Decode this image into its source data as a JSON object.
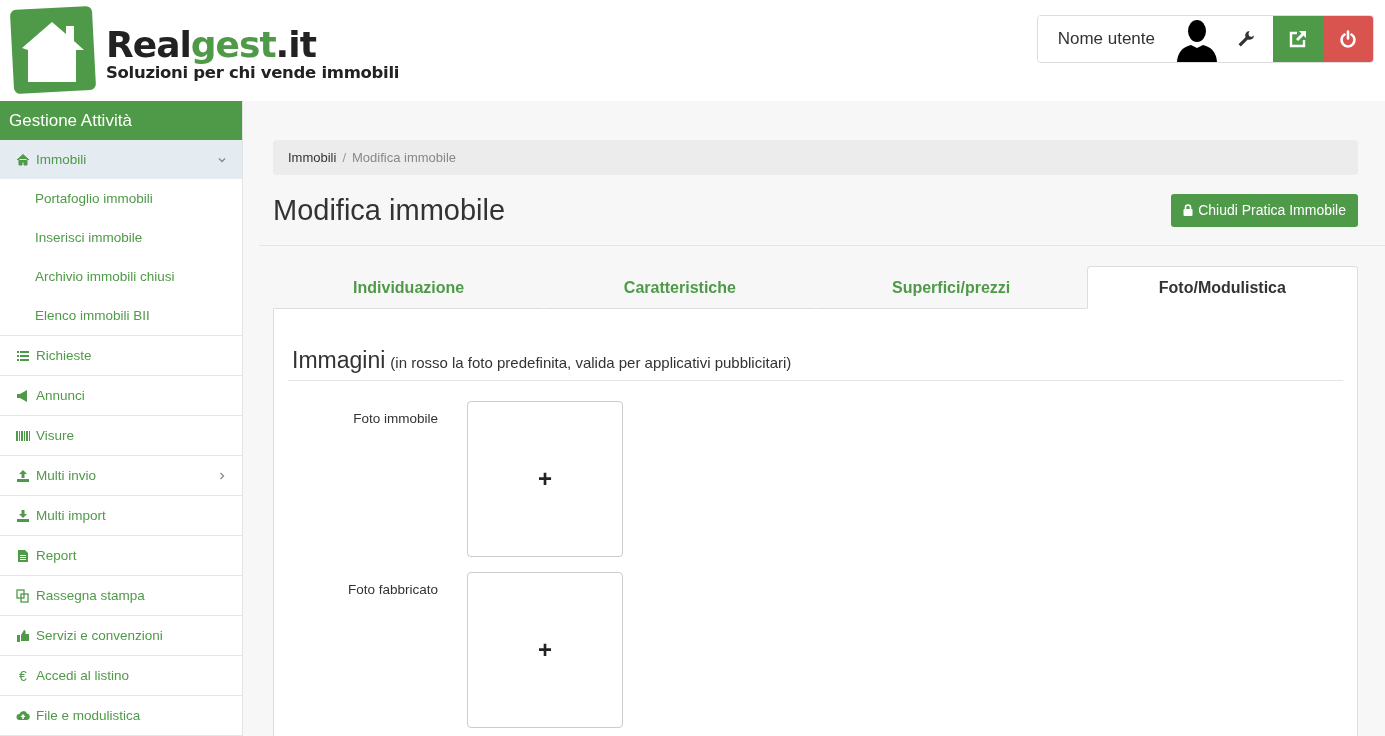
{
  "logo": {
    "brand_dark": "Real",
    "brand_green": "gest",
    "brand_suffix": ".it",
    "tagline": "Soluzioni per chi vende immobili"
  },
  "user_bar": {
    "user_name": "Nome utente"
  },
  "sidebar": {
    "title": "Gestione Attività",
    "items": [
      {
        "label": "Immobili",
        "kind": "group",
        "expanded": true,
        "selected": true,
        "children": [
          {
            "label": "Portafoglio immobili"
          },
          {
            "label": "Inserisci immobile"
          },
          {
            "label": "Archivio immobili chiusi"
          },
          {
            "label": "Elenco immobili BII"
          }
        ]
      },
      {
        "label": "Richieste",
        "kind": "link",
        "selected": false
      },
      {
        "label": "Annunci",
        "kind": "link",
        "selected": false
      },
      {
        "label": "Visure",
        "kind": "link",
        "selected": false
      },
      {
        "label": "Multi invio",
        "kind": "group",
        "expanded": false,
        "selected": false
      },
      {
        "label": "Multi import",
        "kind": "link",
        "selected": false
      },
      {
        "label": "Report",
        "kind": "link",
        "selected": false
      },
      {
        "label": "Rassegna stampa",
        "kind": "link",
        "selected": false
      },
      {
        "label": "Servizi e convenzioni",
        "kind": "link",
        "selected": false
      },
      {
        "label": "Accedi al listino",
        "kind": "link",
        "symbol": "€",
        "selected": false
      },
      {
        "label": "File e modulistica",
        "kind": "link",
        "selected": false
      }
    ]
  },
  "breadcrumb_separator": "/",
  "breadcrumb": [
    {
      "label": "Immobili"
    },
    {
      "label": "Modifica immobile"
    }
  ],
  "page_title": "Modifica immobile",
  "close_button": "Chiudi Pratica Immobile",
  "tabs": [
    {
      "label": "Individuazione",
      "selected": false
    },
    {
      "label": "Caratteristiche",
      "selected": false
    },
    {
      "label": "Superfici/prezzi",
      "selected": false
    },
    {
      "label": "Foto/Modulistica",
      "selected": true
    }
  ],
  "section": {
    "title": "Immagini",
    "note": "(in rosso la foto predefinita, valida per applicativi pubblicitari)"
  },
  "photo_slots": [
    {
      "label": "Foto immobile",
      "add": "+"
    },
    {
      "label": "Foto fabbricato",
      "add": "+"
    }
  ]
}
